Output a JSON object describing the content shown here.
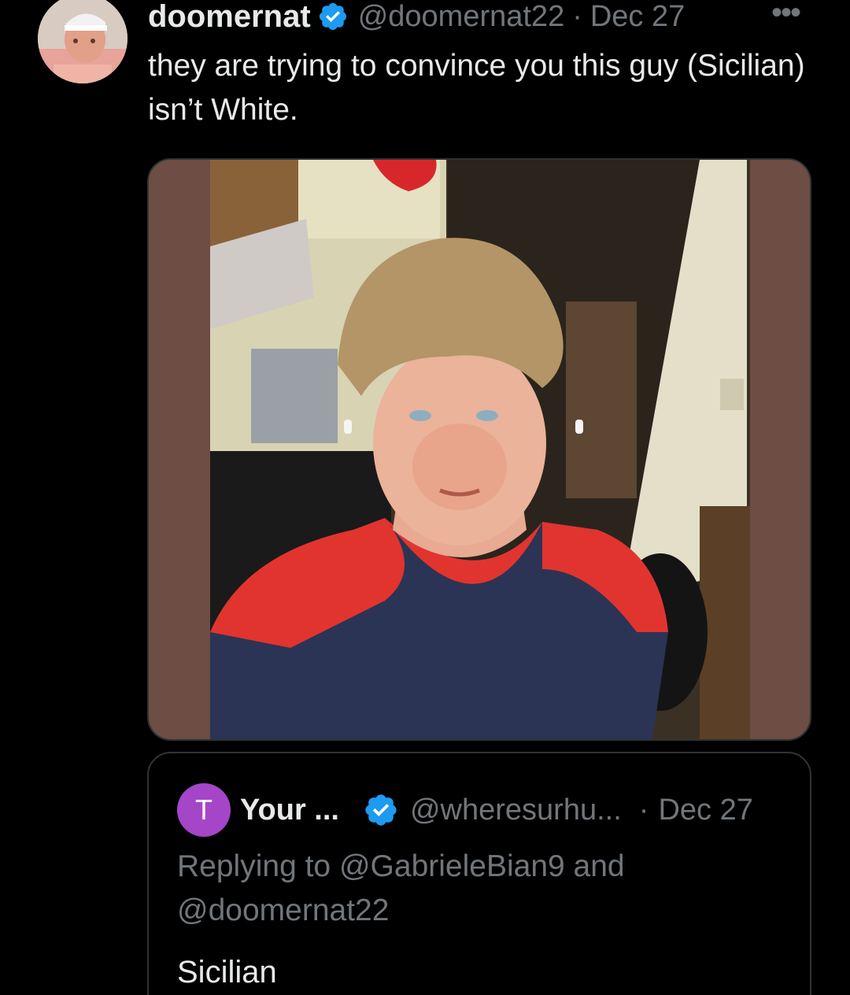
{
  "tweet": {
    "display_name": "doomernat",
    "handle": "@doomernat22",
    "separator": "·",
    "date": "Dec 27",
    "more_label": "•••",
    "text": "they are trying to convince you this guy (Sicilian) isn’t White.",
    "verified_icon": "verified-badge-icon",
    "avatar_icon": "user-avatar-photo"
  },
  "quote": {
    "avatar_letter": "T",
    "avatar_color": "#a545c8",
    "display_name": "Your ...",
    "handle": "@wheresurhu...",
    "separator": "·",
    "date": "Dec 27",
    "replying_to": "Replying to @GabrieleBian9 and @doomernat22",
    "text": "Sicilian"
  },
  "colors": {
    "background": "#000000",
    "text_primary": "#e7e9ea",
    "text_secondary": "#71767b",
    "verified_blue": "#1d9bf0",
    "border": "#2f3336"
  }
}
